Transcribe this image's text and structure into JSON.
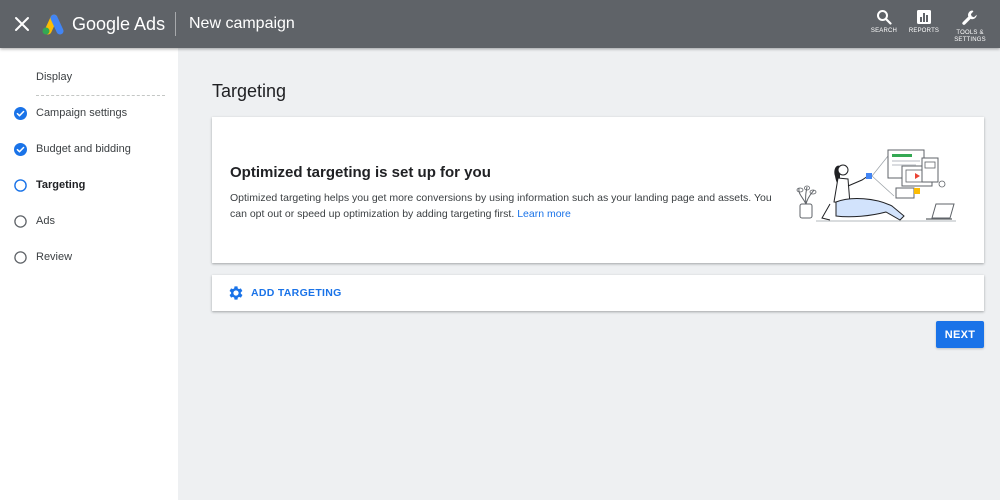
{
  "topbar": {
    "product_name": "Google Ads",
    "page_heading": "New campaign",
    "tools": [
      {
        "label": "SEARCH",
        "icon": "search-icon"
      },
      {
        "label": "REPORTS",
        "icon": "reports-icon"
      },
      {
        "label": "TOOLS &",
        "label2": "SETTINGS",
        "icon": "wrench-icon"
      }
    ]
  },
  "sidebar": {
    "campaign_type": "Display",
    "steps": [
      {
        "label": "Campaign settings",
        "state": "complete"
      },
      {
        "label": "Budget and bidding",
        "state": "complete"
      },
      {
        "label": "Targeting",
        "state": "current"
      },
      {
        "label": "Ads",
        "state": "pending"
      },
      {
        "label": "Review",
        "state": "pending"
      }
    ]
  },
  "main": {
    "title": "Targeting",
    "card": {
      "title": "Optimized targeting is set up for you",
      "description": "Optimized targeting helps you get more conversions by using information such as your landing page and assets. You can opt out or speed up optimization by adding targeting first.",
      "link": "Learn more"
    },
    "add_targeting": "ADD TARGETING",
    "next": "NEXT"
  },
  "colors": {
    "topbar": "#5f6368",
    "accent": "#1a73e8",
    "background": "#eef0f2"
  }
}
